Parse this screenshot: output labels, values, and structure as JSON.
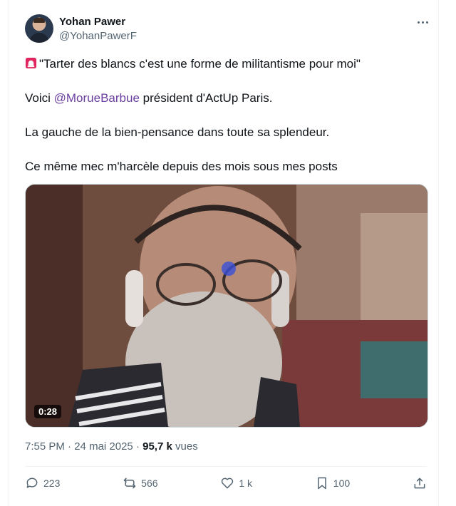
{
  "author": {
    "name": "Yohan Pawer",
    "handle": "@YohanPawerF"
  },
  "tweet": {
    "line1": "\"Tarter des blancs c'est une forme de militantisme pour moi\"",
    "line2_prefix": "Voici ",
    "line2_mention": "@MorueBarbue",
    "line2_suffix": " président d'ActUp Paris.",
    "line3": "La gauche de la bien-pensance dans toute sa splendeur.",
    "line4": "Ce même mec m'harcèle depuis des mois sous mes posts"
  },
  "media": {
    "duration": "0:28"
  },
  "meta": {
    "time": "7:55 PM",
    "separator": " · ",
    "date": "24 mai 2025",
    "views_count": "95,7 k",
    "views_label": " vues"
  },
  "actions": {
    "replies": "223",
    "reposts": "566",
    "likes": "1 k",
    "bookmarks": "100"
  },
  "colors": {
    "mention": "#6b3fa0",
    "secondary_text": "#536471"
  },
  "icons": [
    "siren-icon",
    "more-icon",
    "reply-icon",
    "repost-icon",
    "like-icon",
    "bookmark-icon",
    "share-icon"
  ]
}
